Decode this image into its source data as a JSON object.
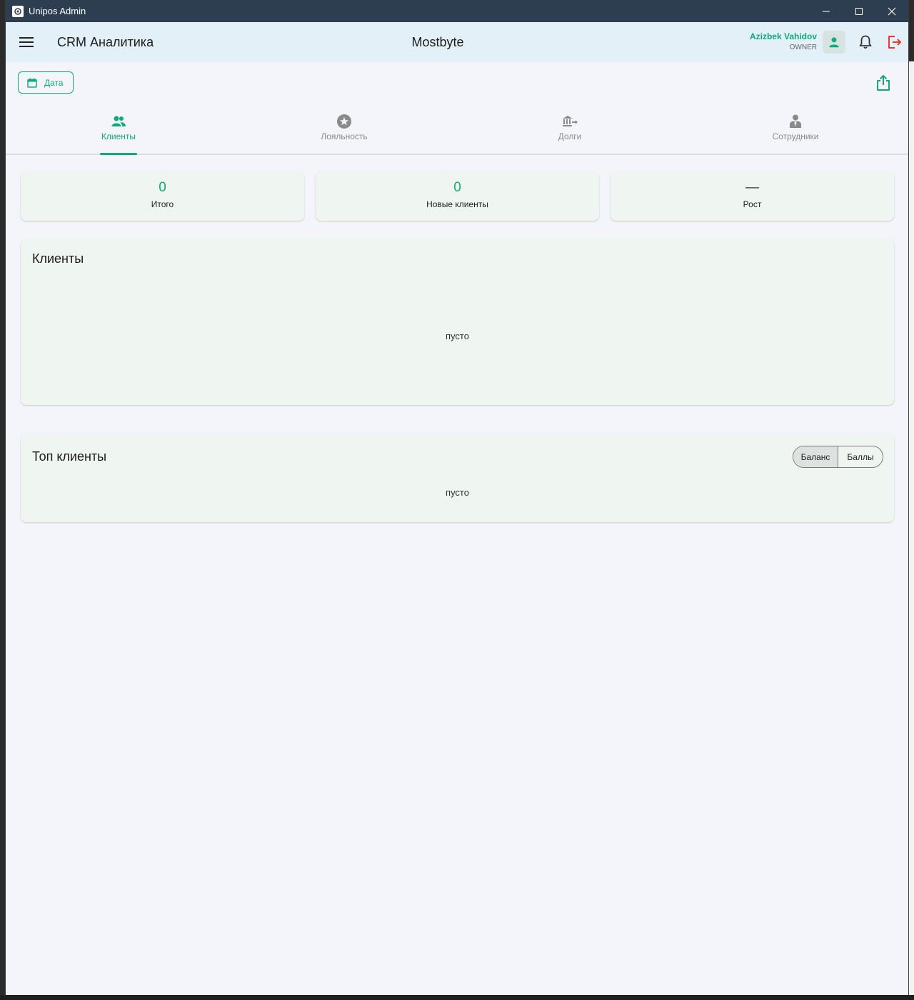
{
  "window": {
    "title": "Unipos Admin"
  },
  "header": {
    "title": "CRM Аналитика",
    "company": "Mostbyte",
    "user_name": "Azizbek Vahidov",
    "user_role": "OWNER"
  },
  "toolbar": {
    "date_label": "Дата"
  },
  "tabs": [
    {
      "label": "Клиенты",
      "icon": "people-icon",
      "active": true
    },
    {
      "label": "Лояльность",
      "icon": "star-icon",
      "active": false
    },
    {
      "label": "Долги",
      "icon": "bank-transfer-icon",
      "active": false
    },
    {
      "label": "Сотрудники",
      "icon": "employee-icon",
      "active": false
    }
  ],
  "stats": [
    {
      "value": "0",
      "label": "Итого"
    },
    {
      "value": "0",
      "label": "Новые клиенты"
    },
    {
      "value": "—",
      "label": "Рост"
    }
  ],
  "clients_panel": {
    "title": "Клиенты",
    "empty_text": "пусто"
  },
  "top_clients_panel": {
    "title": "Топ клиенты",
    "empty_text": "пусто",
    "segments": [
      "Баланс",
      "Баллы"
    ],
    "selected": "Баланс"
  },
  "colors": {
    "accent": "#12a97a",
    "titlebar": "#2d3e50",
    "logout": "#e53935"
  }
}
